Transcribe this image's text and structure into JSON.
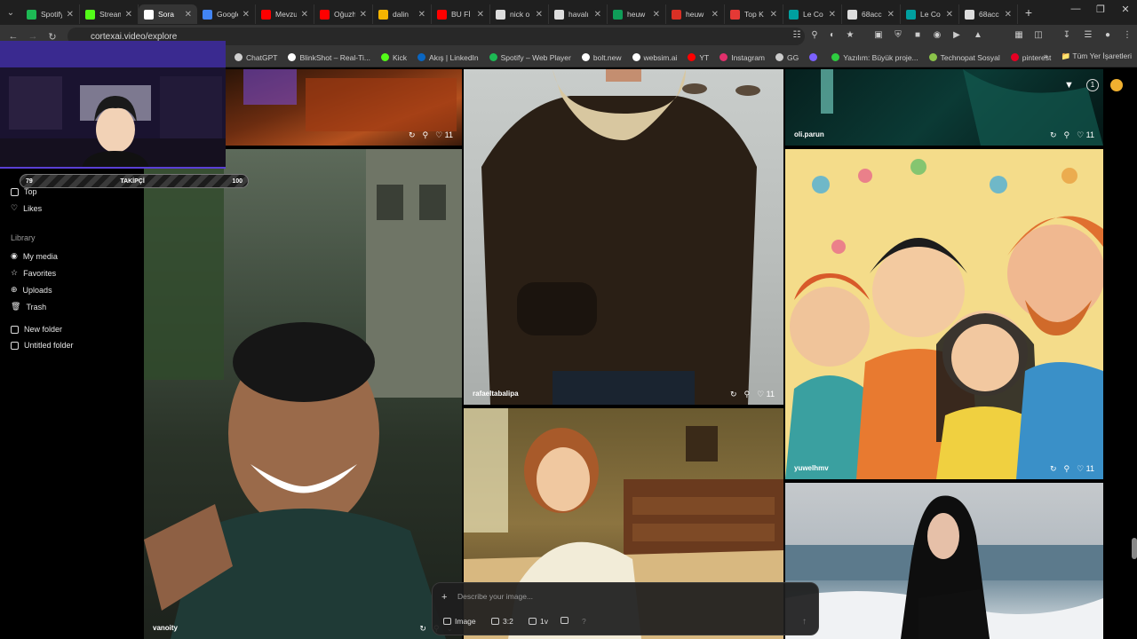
{
  "tabs": [
    {
      "label": "Spotify",
      "color": "#1db954"
    },
    {
      "label": "Stream",
      "color": "#53fc18"
    },
    {
      "label": "Sora",
      "color": "#ffffff"
    },
    {
      "label": "Google",
      "color": "#4285f4"
    },
    {
      "label": "Mevzu",
      "color": "#ff0000"
    },
    {
      "label": "Oğuzh",
      "color": "#ff0000"
    },
    {
      "label": "dalin",
      "color": "#f4b400"
    },
    {
      "label": "BU Fİ",
      "color": "#ff0000"
    },
    {
      "label": "nick o",
      "color": "#dddddd"
    },
    {
      "label": "havalı",
      "color": "#dddddd"
    },
    {
      "label": "heuw",
      "color": "#0f9d58"
    },
    {
      "label": "heuw",
      "color": "#d93025"
    },
    {
      "label": "Top K",
      "color": "#e53935"
    },
    {
      "label": "Le Co",
      "color": "#00a0a0"
    },
    {
      "label": "68acc",
      "color": "#dddddd"
    },
    {
      "label": "Le Co",
      "color": "#00a0a0"
    },
    {
      "label": "68acc",
      "color": "#dddddd"
    }
  ],
  "active_tab_index": 2,
  "address_bar": {
    "url": "cortexai.video/explore"
  },
  "bookmarks": [
    {
      "label": "ChatGPT",
      "color": "#cfcfcf"
    },
    {
      "label": "BlinkShot – Real-Ti...",
      "color": "#ffffff"
    },
    {
      "label": "Kick",
      "color": "#53fc18"
    },
    {
      "label": "Akış | LinkedIn",
      "color": "#0a66c2"
    },
    {
      "label": "Spotify – Web Player",
      "color": "#1db954"
    },
    {
      "label": "bolt.new",
      "color": "#ffffff"
    },
    {
      "label": "websim.ai",
      "color": "#ffffff"
    },
    {
      "label": "YT",
      "color": "#ff0000"
    },
    {
      "label": "Instagram",
      "color": "#e1306c"
    },
    {
      "label": "GG",
      "color": "#cccccc"
    },
    {
      "label": "",
      "color": "#7b61ff"
    },
    {
      "label": "Yazılım: Büyük proje...",
      "color": "#2ecc40"
    },
    {
      "label": "Technopat Sosyal",
      "color": "#8bc34a"
    },
    {
      "label": "pinterest",
      "color": "#e60023"
    }
  ],
  "bookmarks_all_label": "Tüm Yer İşaretleri",
  "sidebar": {
    "top_items": [
      "Top",
      "Likes"
    ],
    "library_heading": "Library",
    "library_items": [
      "My media",
      "Favorites",
      "Uploads",
      "Trash"
    ],
    "folders": [
      "New folder",
      "Untitled folder"
    ]
  },
  "overlay": {
    "follow_left": "79",
    "follow_label": "TAKİPÇİ",
    "follow_right": "100",
    "follow_progress": 0.79
  },
  "cards": [
    {
      "user": "",
      "likes": "11"
    },
    {
      "user": "vanoity",
      "likes": ""
    },
    {
      "user": "rafaeltabalipa",
      "likes": "11"
    },
    {
      "user": "",
      "likes": ""
    },
    {
      "user": "oli.parun",
      "likes": "11"
    },
    {
      "user": "yuwelhmv",
      "likes": "11"
    },
    {
      "user": "",
      "likes": ""
    }
  ],
  "top_controls": {
    "notification_count": "1"
  },
  "prompt": {
    "placeholder": "Describe your image...",
    "mode_label": "Image",
    "ratio_label": "3:2",
    "count_label": "1v",
    "help_label": "?"
  }
}
